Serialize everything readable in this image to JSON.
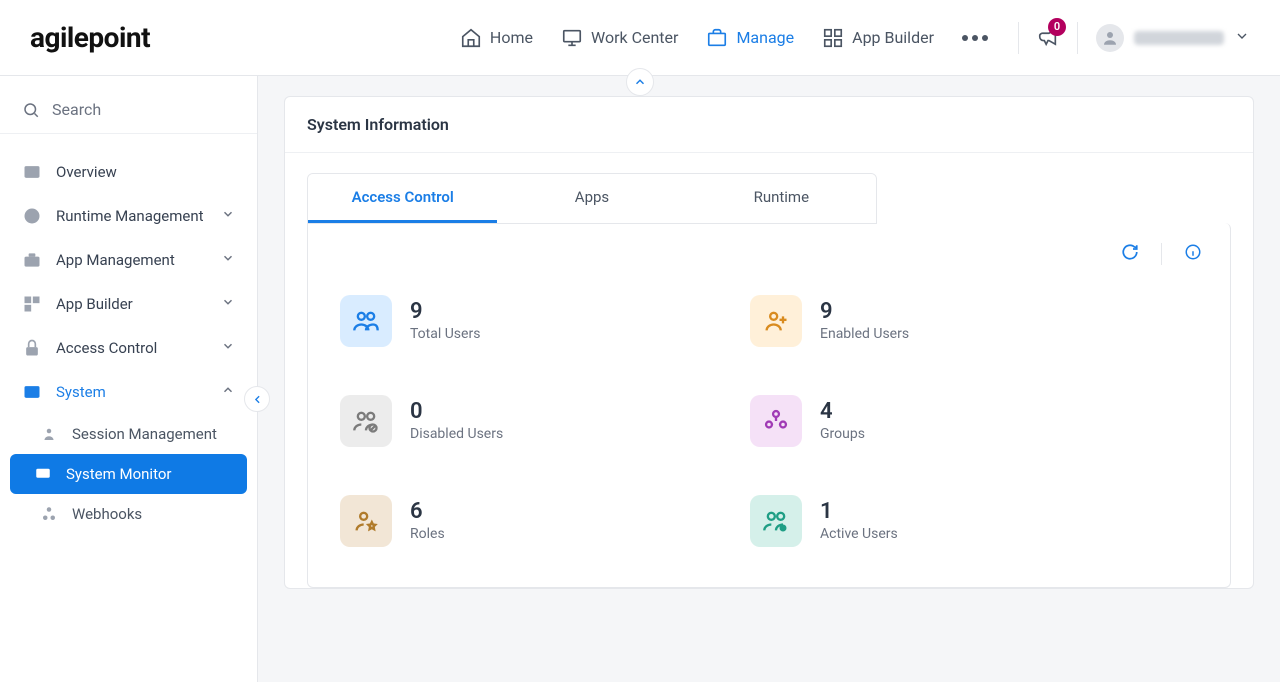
{
  "brand": {
    "text": "agilepoint"
  },
  "topnav": {
    "home": "Home",
    "work_center": "Work Center",
    "manage": "Manage",
    "app_builder": "App Builder"
  },
  "notification": {
    "count": "0"
  },
  "search": {
    "placeholder": "Search"
  },
  "sidebar": {
    "overview": "Overview",
    "runtime_mgmt": "Runtime Management",
    "app_mgmt": "App Management",
    "app_builder": "App Builder",
    "access_control": "Access Control",
    "system": "System",
    "session_mgmt": "Session Management",
    "system_monitor": "System Monitor",
    "webhooks": "Webhooks"
  },
  "panel": {
    "title": "System Information",
    "tabs": {
      "access_control": "Access Control",
      "apps": "Apps",
      "runtime": "Runtime"
    }
  },
  "stats": {
    "total_users": {
      "value": "9",
      "label": "Total Users"
    },
    "enabled_users": {
      "value": "9",
      "label": "Enabled Users"
    },
    "disabled_users": {
      "value": "0",
      "label": "Disabled Users"
    },
    "groups": {
      "value": "4",
      "label": "Groups"
    },
    "roles": {
      "value": "6",
      "label": "Roles"
    },
    "active_users": {
      "value": "1",
      "label": "Active Users"
    }
  }
}
